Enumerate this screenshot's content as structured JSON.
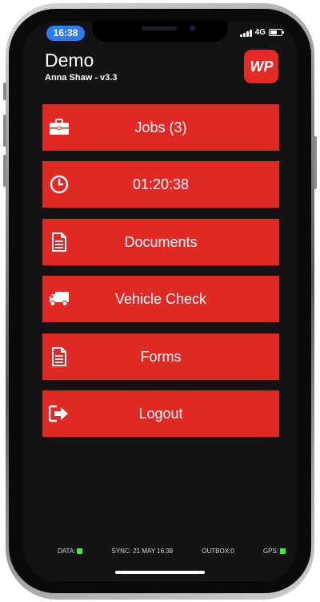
{
  "status_bar": {
    "time": "16:38",
    "network": "4G"
  },
  "header": {
    "title": "Demo",
    "user_version": "Anna Shaw - v3.3",
    "logo_text": "WP"
  },
  "menu": [
    {
      "label": "Jobs (3)",
      "icon": "briefcase-icon"
    },
    {
      "label": "01:20:38",
      "icon": "clock-icon"
    },
    {
      "label": "Documents",
      "icon": "document-icon"
    },
    {
      "label": "Vehicle Check",
      "icon": "truck-icon"
    },
    {
      "label": "Forms",
      "icon": "document-icon"
    },
    {
      "label": "Logout",
      "icon": "logout-icon"
    }
  ],
  "footer": {
    "data_label": "DATA:",
    "sync_text": "SYNC: 21 MAY 16:38",
    "outbox_text": "OUTBOX:0",
    "gps_label": "GPS:"
  },
  "colors": {
    "accent": "#e02824",
    "background": "#131316",
    "status_ok": "#3ee63e",
    "time_pill": "#2f7bf2"
  }
}
